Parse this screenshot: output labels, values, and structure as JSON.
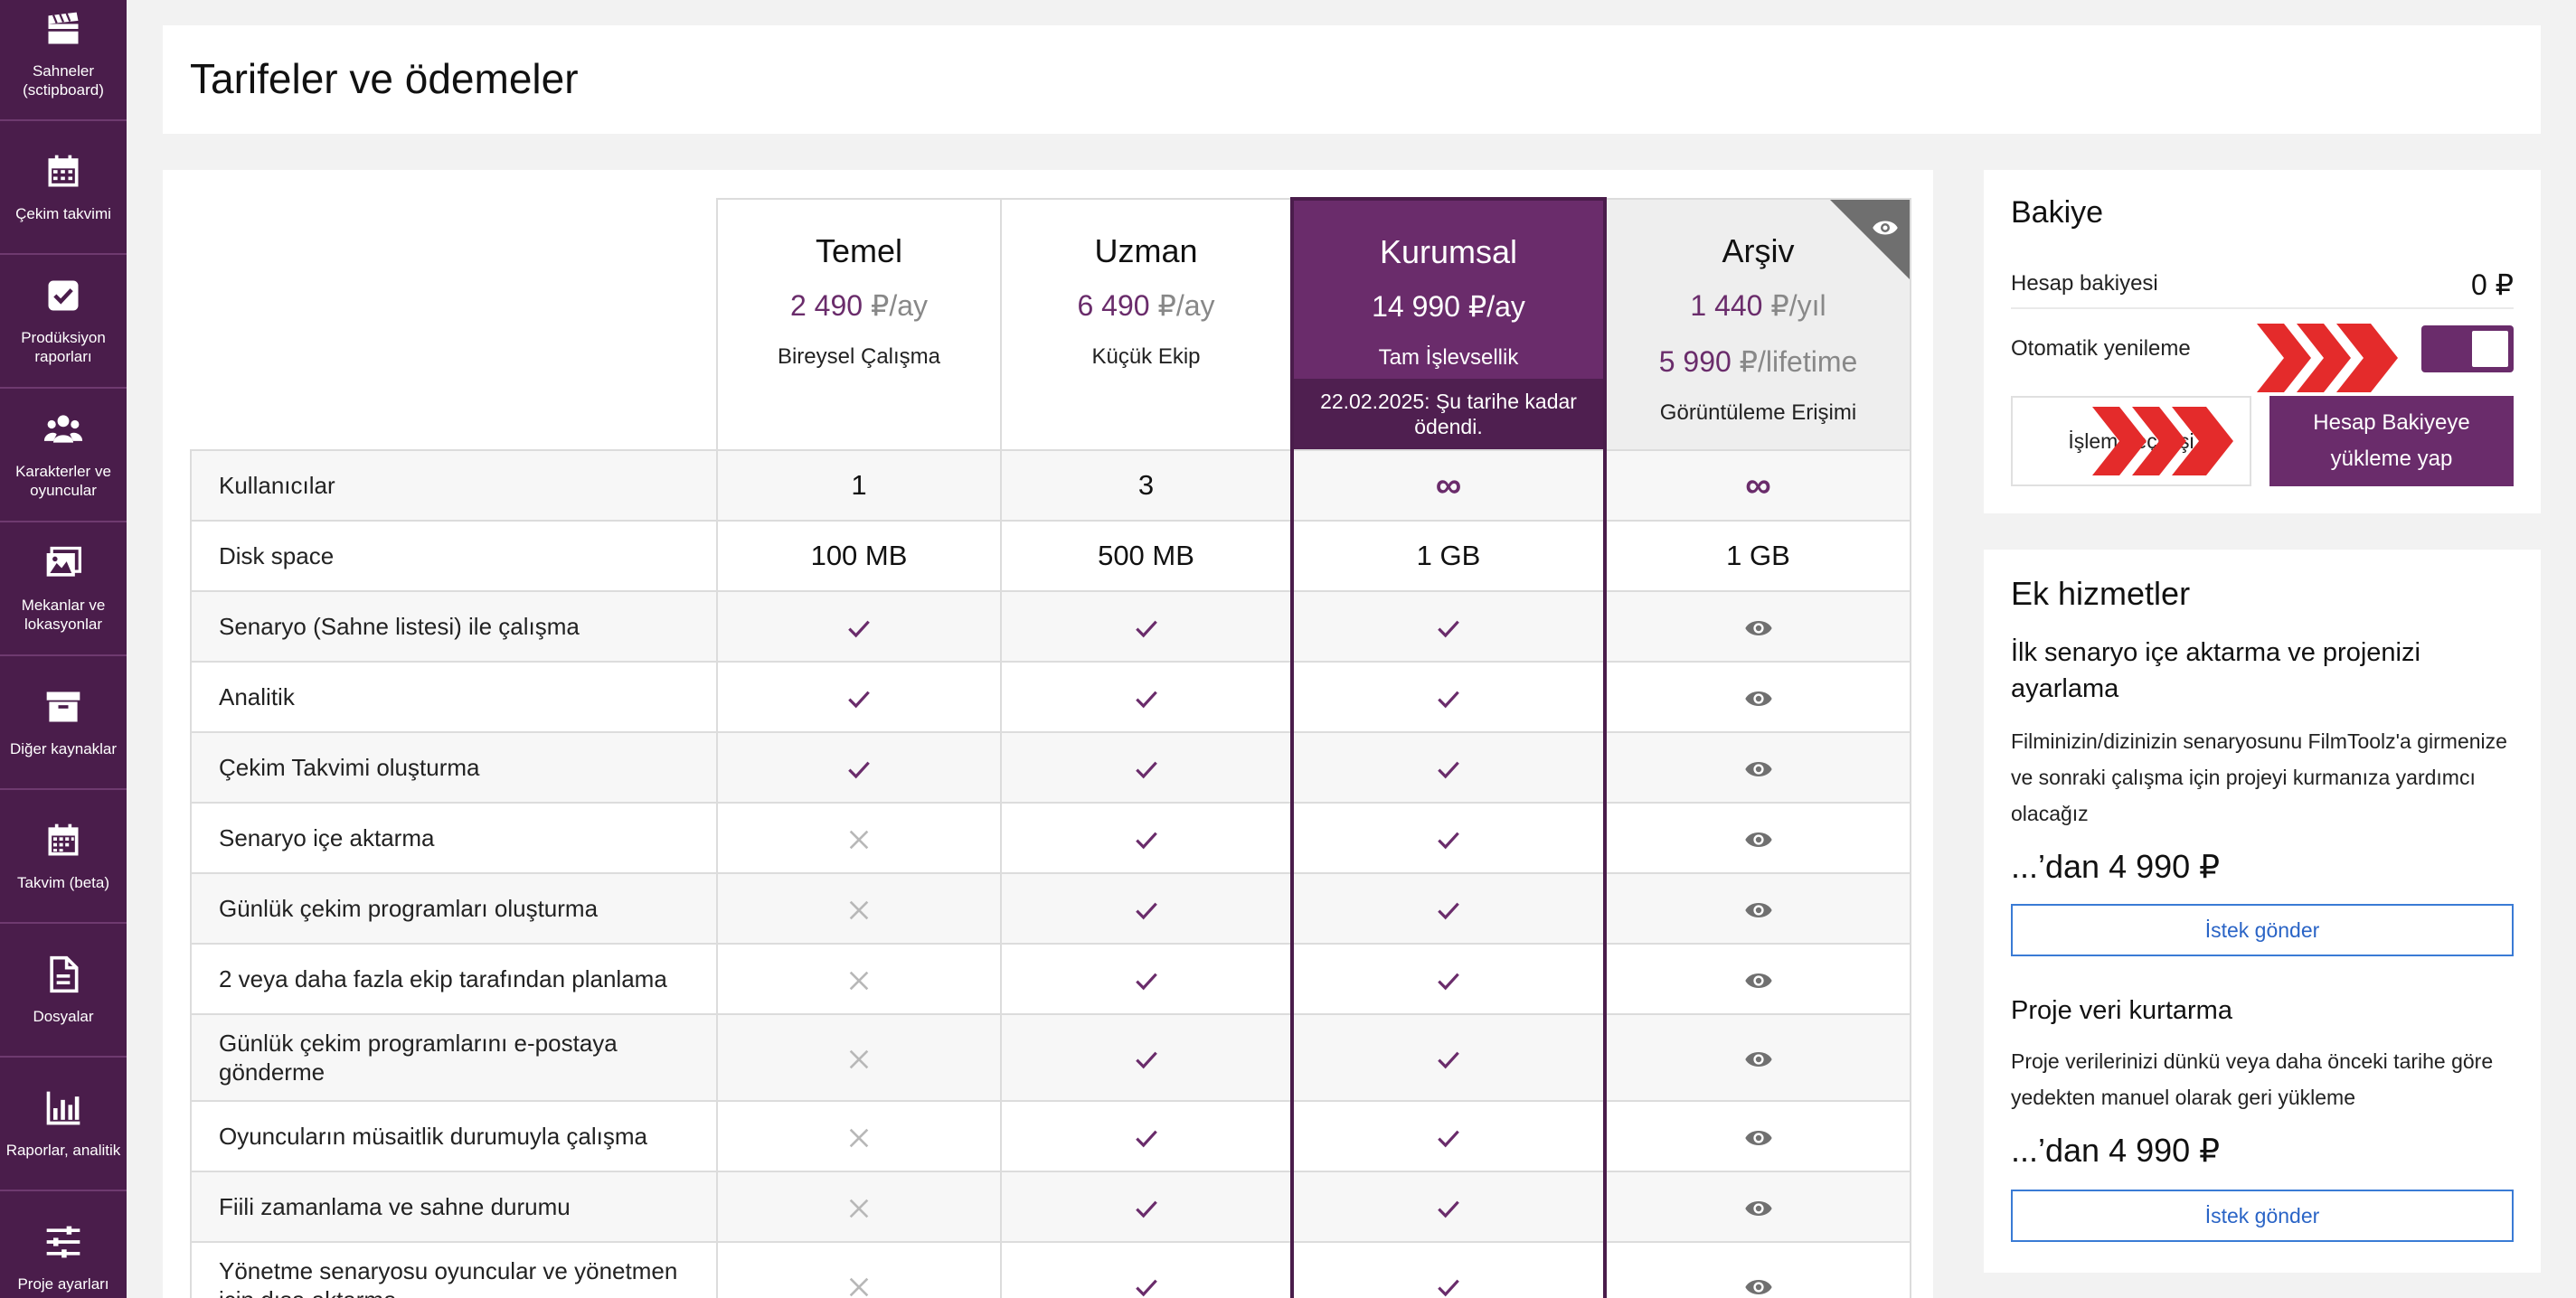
{
  "sidebar": {
    "items": [
      {
        "label": "Sahneler (sctipboard)",
        "icon": "clapperboard-icon"
      },
      {
        "label": "Çekim takvimi",
        "icon": "calendar-icon"
      },
      {
        "label": "Prodüksiyon raporları",
        "icon": "checkbox-icon"
      },
      {
        "label": "Karakterler ve oyuncular",
        "icon": "people-icon"
      },
      {
        "label": "Mekanlar ve lokasyonlar",
        "icon": "image-icon"
      },
      {
        "label": "Diğer kaynaklar",
        "icon": "archive-box-icon"
      },
      {
        "label": "Takvim (beta)",
        "icon": "calendar-grid-icon"
      },
      {
        "label": "Dosyalar",
        "icon": "document-icon"
      },
      {
        "label": "Raporlar, analitik",
        "icon": "bar-chart-icon"
      },
      {
        "label": "Proje ayarları",
        "icon": "sliders-icon"
      }
    ]
  },
  "page": {
    "title": "Tarifeler ve ödemeler"
  },
  "plans": [
    {
      "name": "Temel",
      "price": "2 490",
      "unit": "₽/ay",
      "subtitle": "Bireysel Çalışma"
    },
    {
      "name": "Uzman",
      "price": "6 490",
      "unit": "₽/ay",
      "subtitle": "Küçük Ekip"
    },
    {
      "name": "Kurumsal",
      "price": "14 990",
      "unit": "₽/ay",
      "subtitle": "Tam İşlevsellik",
      "paid_note": "22.02.2025: Şu tarihe kadar ödendi."
    },
    {
      "name": "Arşiv",
      "price": "1 440",
      "unit": "₽/yıl",
      "price2": "5 990",
      "unit2": "₽/lifetime",
      "subtitle": "Görüntüleme Erişimi"
    }
  ],
  "features": [
    {
      "label": "Kullanıcılar",
      "values": [
        "1",
        "3",
        "∞",
        "∞"
      ]
    },
    {
      "label": "Disk space",
      "values": [
        "100 MB",
        "500 MB",
        "1 GB",
        "1 GB"
      ]
    },
    {
      "label": "Senaryo (Sahne listesi) ile çalışma",
      "values": [
        "check",
        "check",
        "check",
        "eye"
      ]
    },
    {
      "label": "Analitik",
      "values": [
        "check",
        "check",
        "check",
        "eye"
      ]
    },
    {
      "label": "Çekim Takvimi oluşturma",
      "values": [
        "check",
        "check",
        "check",
        "eye"
      ]
    },
    {
      "label": "Senaryo içe aktarma",
      "values": [
        "cross",
        "check",
        "check",
        "eye"
      ]
    },
    {
      "label": "Günlük çekim programları oluşturma",
      "values": [
        "cross",
        "check",
        "check",
        "eye"
      ]
    },
    {
      "label": "2 veya daha fazla ekip tarafından planlama",
      "values": [
        "cross",
        "check",
        "check",
        "eye"
      ]
    },
    {
      "label": "Günlük çekim programlarını e-postaya gönderme",
      "values": [
        "cross",
        "check",
        "check",
        "eye"
      ]
    },
    {
      "label": "Oyuncuların müsaitlik durumuyla çalışma",
      "values": [
        "cross",
        "check",
        "check",
        "eye"
      ]
    },
    {
      "label": "Fiili zamanlama ve sahne durumu",
      "values": [
        "cross",
        "check",
        "check",
        "eye"
      ]
    },
    {
      "label": "Yönetme senaryosu oyuncular ve yönetmen için dışa aktarma",
      "values": [
        "cross",
        "check",
        "check",
        "eye"
      ]
    }
  ],
  "balance": {
    "title": "Bakiye",
    "account_label": "Hesap bakiyesi",
    "account_value": "0 ₽",
    "auto_renew_label": "Otomatik yenileme",
    "auto_renew_on": true,
    "history_button": "İşlem geçmişi",
    "topup_button": "Hesap Bakiyeye yükleme yap"
  },
  "extra": {
    "title": "Ek hizmetler",
    "services": [
      {
        "title": "İlk senaryo içe aktarma ve projenizi ayarlama",
        "description": "Filminizin/dizinizin senaryosunu FilmToolz'a girmenize ve sonraki çalışma için projeyi kurmanıza yardımcı olacağız",
        "price": "...’dan 4 990 ₽",
        "button": "İstek gönder"
      },
      {
        "title": "Proje veri kurtarma",
        "description": "Proje verilerinizi dünkü veya daha önceki tarihe göre yedekten manuel olarak geri yükleme",
        "price": "...’dan 4 990 ₽",
        "button": "İstek gönder"
      }
    ]
  },
  "colors": {
    "brand": "#6a2c6b",
    "sidebar": "#4a1d4b",
    "arrow": "#e42b2b",
    "link": "#2a64c6"
  }
}
